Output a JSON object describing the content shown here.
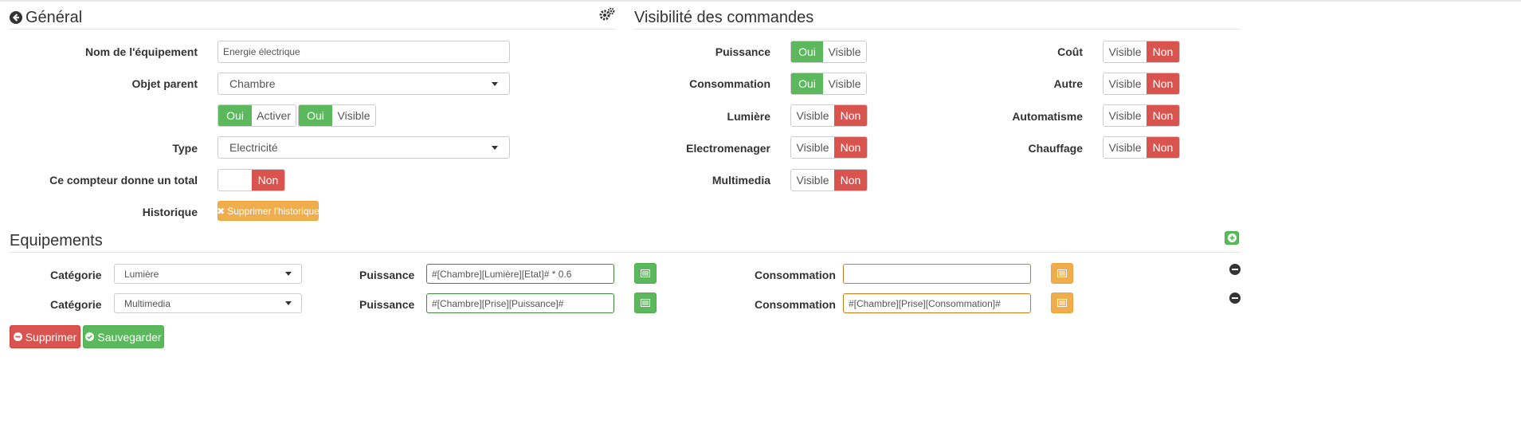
{
  "general": {
    "title": "Général",
    "labels": {
      "nom": "Nom de l'équipement",
      "objet": "Objet parent",
      "type": "Type",
      "compteur": "Ce compteur donne un total",
      "historique": "Historique"
    },
    "nom_value": "Energie électrique",
    "objet_selected": "Chambre",
    "activer": {
      "on_label": "Oui",
      "label": "Activer"
    },
    "visible": {
      "on_label": "Oui",
      "label": "Visible"
    },
    "type_selected": "Electricité",
    "compteur_toggle": {
      "off_label": "Non"
    },
    "supprimer_historique": "Supprimer l'historique"
  },
  "visibilite": {
    "title": "Visibilité des commandes",
    "left": [
      {
        "label": "Puissance",
        "state": "on",
        "on_text": "Oui",
        "text": "Visible"
      },
      {
        "label": "Consommation",
        "state": "on",
        "on_text": "Oui",
        "text": "Visible"
      },
      {
        "label": "Lumière",
        "state": "off",
        "text": "Visible",
        "off_text": "Non"
      },
      {
        "label": "Electromenager",
        "state": "off",
        "text": "Visible",
        "off_text": "Non"
      },
      {
        "label": "Multimedia",
        "state": "off",
        "text": "Visible",
        "off_text": "Non"
      }
    ],
    "right": [
      {
        "label": "Coût",
        "state": "off",
        "text": "Visible",
        "off_text": "Non"
      },
      {
        "label": "Autre",
        "state": "off",
        "text": "Visible",
        "off_text": "Non"
      },
      {
        "label": "Automatisme",
        "state": "off",
        "text": "Visible",
        "off_text": "Non"
      },
      {
        "label": "Chauffage",
        "state": "off",
        "text": "Visible",
        "off_text": "Non"
      }
    ]
  },
  "equipements": {
    "title": "Equipements",
    "rows": [
      {
        "categorie_label": "Catégorie",
        "categorie": "Lumière",
        "puissance_label": "Puissance",
        "puissance": "#[Chambre][Lumière][Etat]# * 0.6",
        "conso_label": "Consommation",
        "conso": ""
      },
      {
        "categorie_label": "Catégorie",
        "categorie": "Multimedia",
        "puissance_label": "Puissance",
        "puissance": "#[Chambre][Prise][Puissance]#",
        "conso_label": "Consommation",
        "conso": "#[Chambre][Prise][Consommation]#"
      }
    ]
  },
  "actions": {
    "supprimer": "Supprimer",
    "sauvegarder": "Sauvegarder"
  },
  "colors": {
    "green": "#5cb85c",
    "red": "#d9534f",
    "orange": "#f0ad4e"
  },
  "icons": [
    "arrow-circle-left-icon",
    "gears-icon",
    "plus-circle-icon",
    "minus-circle-icon",
    "list-alt-icon",
    "times-icon",
    "minus-circle-icon",
    "check-circle-icon"
  ]
}
